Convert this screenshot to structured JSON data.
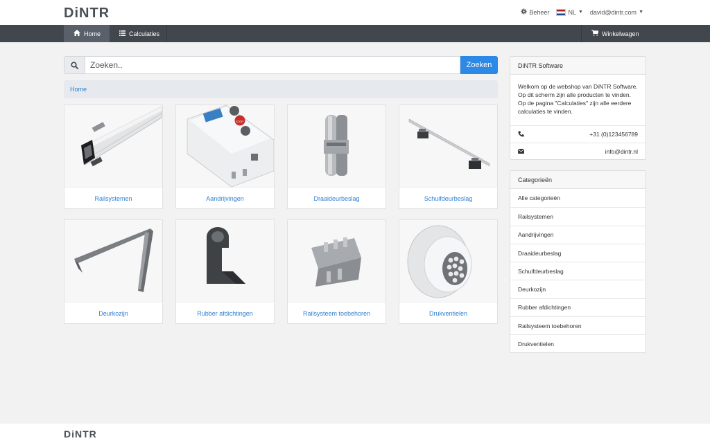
{
  "header": {
    "logo": "DiNTR",
    "admin_label": "Beheer",
    "language": "NL",
    "user_email": "david@dintr.com"
  },
  "nav": {
    "home": "Home",
    "calculations": "Calculaties",
    "cart": "Winkelwagen"
  },
  "search": {
    "placeholder": "Zoeken..",
    "button": "Zoeken"
  },
  "breadcrumb": {
    "home": "Home"
  },
  "products": [
    "Railsystemen",
    "Aandrijvingen",
    "Draaideurbeslag",
    "Schuifdeurbeslag",
    "Deurkozijn",
    "Rubber afdichtingen",
    "Railsysteem toebehoren",
    "Drukventielen"
  ],
  "info_panel": {
    "title": "DiNTR Software",
    "welcome": "Welkom op de webshop van DiNTR Software. Op dit scherm zijn alle producten te vinden. Op de pagina \"Calculaties\" zijn alle eerdere calculaties te vinden.",
    "phone": "+31 (0)123456789",
    "email": "info@dintr.nl"
  },
  "categories_panel": {
    "title": "Categorieën",
    "items": [
      "Alle categorieën",
      "Railsystemen",
      "Aandrijvingen",
      "Draaideurbeslag",
      "Schuifdeurbeslag",
      "Deurkozijn",
      "Rubber afdichtingen",
      "Railsysteem toebehoren",
      "Drukventielen"
    ]
  },
  "footer": {
    "logo": "DiNTR"
  },
  "colors": {
    "navbar": "#42474e",
    "accent": "#2d89e6",
    "link": "#2d7fd2",
    "background": "#f2f2f2"
  }
}
